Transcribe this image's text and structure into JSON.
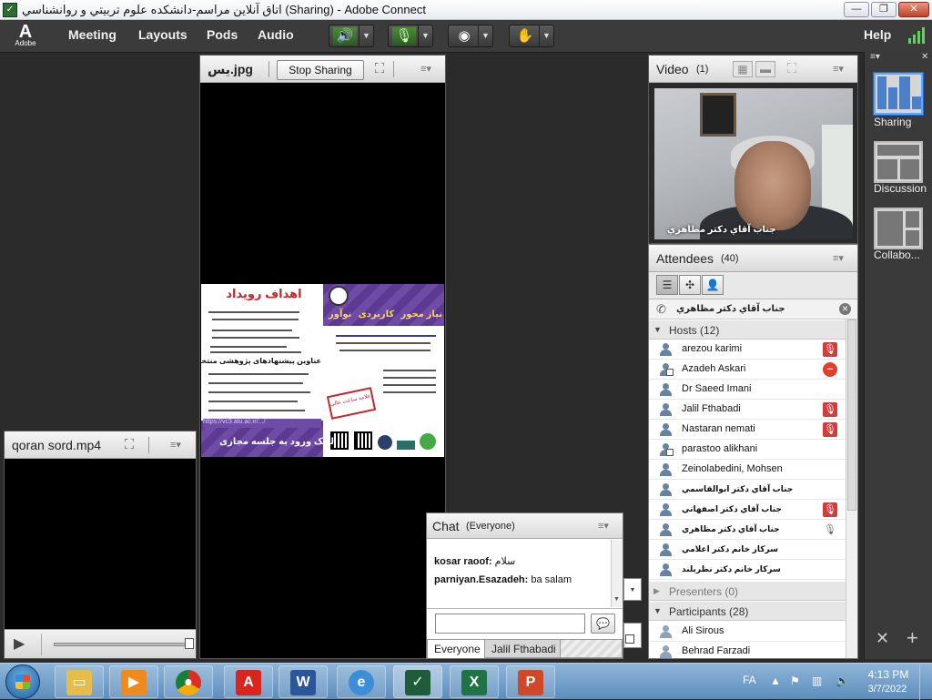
{
  "window": {
    "title": "اتاق آنلاین مراسم-دانشکده علوم تربیتي و روانشناسي (Sharing) - Adobe Connect",
    "minimize": "—",
    "restore": "❐",
    "close": "✕"
  },
  "menubar": {
    "logo_text": "Adobe",
    "items": [
      "Meeting",
      "Layouts",
      "Pods",
      "Audio"
    ],
    "help": "Help"
  },
  "share_pod": {
    "title": "یس.jpg",
    "stop_sharing": "Stop Sharing"
  },
  "poster": {
    "title": "اهداف رویداد",
    "tags": [
      "نیاز محور",
      "کاربردی",
      "نوآور"
    ],
    "subtitle": "عناوین پیشنهادهای پژوهشی منتخب",
    "stamp": "دانشگاه علامه ساعت عالی",
    "link": "https://vc3.atu.ac.ir/.../",
    "bottom": "لینک ورود به جلسه مجازی"
  },
  "file_pod": {
    "title": "qoran sord.mp4"
  },
  "video_pod": {
    "title": "Video",
    "count": "(1)",
    "presenter_label": "جناب آقاي دکتر مظاهري"
  },
  "attendees": {
    "title": "Attendees",
    "count": "(40)",
    "active_speaker": "جناب آقاي دکتر مظاهري",
    "hosts_label": "Hosts (12)",
    "presenters_label": "Presenters (0)",
    "participants_label": "Participants (28)",
    "hosts": [
      {
        "name": "arezou karimi",
        "status": "mic-red"
      },
      {
        "name": "Azadeh Askari",
        "status": "no-entry"
      },
      {
        "name": "Dr Saeed Imani",
        "status": ""
      },
      {
        "name": "Jalil Fthabadi",
        "status": "mic-red"
      },
      {
        "name": "Nastaran nemati",
        "status": "mic-red"
      },
      {
        "name": "parastoo alikhani",
        "status": ""
      },
      {
        "name": "Zeinolabedini, Mohsen",
        "status": ""
      },
      {
        "name": "جناب آقاي دکتر ابوالقاسمي",
        "status": ""
      },
      {
        "name": "جناب آقاي دکتر اصفهاني",
        "status": "mic-red"
      },
      {
        "name": "جناب آقاي دکتر مظاهري",
        "status": "mic-grey"
      },
      {
        "name": "سرکار خانم دکتر اعلامي",
        "status": ""
      },
      {
        "name": "سرکار خانم دکتر نظربلند",
        "status": ""
      }
    ],
    "participants": [
      {
        "name": "Ali Sirous"
      },
      {
        "name": "Behrad Farzadi"
      }
    ]
  },
  "layouts_panel": {
    "items": [
      "Sharing",
      "Discussion",
      "Collabo..."
    ]
  },
  "chat": {
    "title": "Chat",
    "scope": "(Everyone)",
    "messages": [
      {
        "author": "kosar raoof:",
        "text": "سلام"
      },
      {
        "author": "parniyan.Esazadeh:",
        "text": "ba salam"
      }
    ],
    "send_icon": "speech-bubble-icon",
    "tabs": [
      "Everyone",
      "Jalil Fthabadi"
    ]
  },
  "taskbar": {
    "lang": "FA",
    "time": "4:13 PM",
    "date": "3/7/2022"
  }
}
